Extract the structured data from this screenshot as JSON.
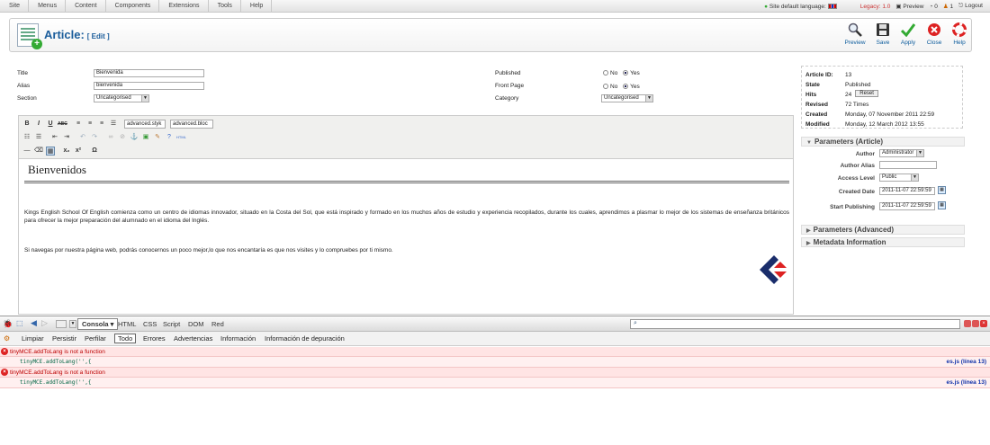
{
  "top_menu": {
    "items": [
      "Site",
      "Menus",
      "Content",
      "Components",
      "Extensions",
      "Tools",
      "Help"
    ],
    "site_language": "Site default language:",
    "legacy": "Legacy: 1.0",
    "preview": "Preview",
    "msgs": "0",
    "users": "1",
    "logout": "Logout"
  },
  "header": {
    "title": "Article:",
    "mode": "[ Edit ]",
    "buttons": [
      "Preview",
      "Save",
      "Apply",
      "Close",
      "Help"
    ]
  },
  "form": {
    "title_label": "Title",
    "title_value": "Bienvenida",
    "alias_label": "Alias",
    "alias_value": "bienvenida",
    "section_label": "Section",
    "section_value": "Uncategorised",
    "published_label": "Published",
    "frontpage_label": "Front Page",
    "category_label": "Category",
    "category_value": "Uncategorised",
    "no": "No",
    "yes": "Yes"
  },
  "editor": {
    "style_select": "advanced.styk",
    "block_select": "advanced.bloc",
    "heading": "Bienvenidos",
    "paragraph1": "Kings English School Of English comienza como un centro de idiomas innovador, situado en la Costa del Sol, que está inspirado y formado en los muchos años de estudio y experiencia recopilados, durante los cuales, aprendimos a plasmar lo mejor de los sistemas de enseñanza británicos para ofrecer la mejor preparación del alumnado en el idioma del Inglés.",
    "paragraph2": "Si navegas por nuestra página web, podrás conocernos un poco mejor,lo que nos encantaría es que nos visites y lo compruebes por ti mismo."
  },
  "info": {
    "rows": [
      {
        "k": "Article ID:",
        "v": "13"
      },
      {
        "k": "State",
        "v": "Published"
      },
      {
        "k": "Hits",
        "v": "24"
      },
      {
        "k": "Revised",
        "v": "72 Times"
      },
      {
        "k": "Created",
        "v": "Monday, 07 November 2011 22:59"
      },
      {
        "k": "Modified",
        "v": "Monday, 12 March 2012 13:55"
      }
    ],
    "reset": "Reset"
  },
  "params": {
    "header": "Parameters (Article)",
    "author_label": "Author",
    "author_value": "Administrator",
    "alias_label": "Author Alias",
    "access_label": "Access Level",
    "access_value": "Public",
    "created_label": "Created Date",
    "created_value": "2011-11-07 22:59:59",
    "start_label": "Start Publishing",
    "start_value": "2011-11-07 22:59:59",
    "adv_header": "Parameters (Advanced)",
    "meta_header": "Metadata Information"
  },
  "firebug": {
    "tabs": [
      "Consola",
      "HTML",
      "CSS",
      "Script",
      "DOM",
      "Red"
    ],
    "subtabs": [
      "Limpiar",
      "Persistir",
      "Perfilar",
      "Todo",
      "Errores",
      "Advertencias",
      "Información",
      "Información de depuración"
    ],
    "errors": [
      {
        "msg": "tinyMCE.addToLang is not a function",
        "code": "tinyMCE.addToLang('',{",
        "loc": "es.js (línea 13)"
      },
      {
        "msg": "tinyMCE.addToLang is not a function",
        "code": "tinyMCE.addToLang('',{",
        "loc": "es.js (línea 13)"
      }
    ]
  },
  "colors": {
    "accent": "#1b5d9b",
    "error_bg": "#ffe4e4",
    "error_text": "#bb0000"
  }
}
